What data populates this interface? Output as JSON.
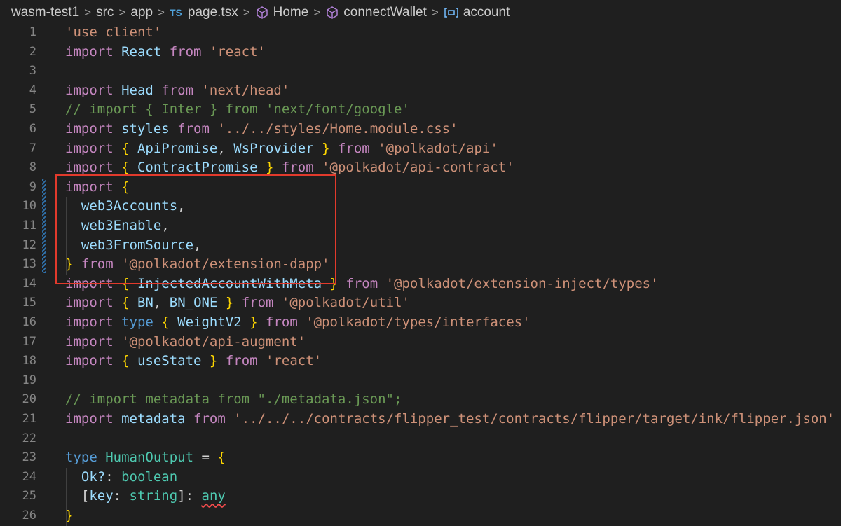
{
  "breadcrumb": {
    "project": "wasm-test1",
    "folder1": "src",
    "folder2": "app",
    "file_badge": "TS",
    "file": "page.tsx",
    "symbol1": "Home",
    "symbol2": "connectWallet",
    "symbol3": "account",
    "separator": ">"
  },
  "editor": {
    "lines": [
      {
        "n": "1",
        "tokens": [
          [
            "str",
            "'use client'"
          ]
        ]
      },
      {
        "n": "2",
        "tokens": [
          [
            "kw2",
            "import "
          ],
          [
            "id",
            "React "
          ],
          [
            "kw2",
            "from "
          ],
          [
            "str",
            "'react'"
          ]
        ]
      },
      {
        "n": "3",
        "tokens": []
      },
      {
        "n": "4",
        "tokens": [
          [
            "kw2",
            "import "
          ],
          [
            "id",
            "Head "
          ],
          [
            "kw2",
            "from "
          ],
          [
            "str",
            "'next/head'"
          ]
        ]
      },
      {
        "n": "5",
        "tokens": [
          [
            "cm",
            "// import { Inter } from 'next/font/google'"
          ]
        ]
      },
      {
        "n": "6",
        "tokens": [
          [
            "kw2",
            "import "
          ],
          [
            "id",
            "styles "
          ],
          [
            "kw2",
            "from "
          ],
          [
            "str",
            "'../../styles/Home.module.css'"
          ]
        ]
      },
      {
        "n": "7",
        "tokens": [
          [
            "kw2",
            "import "
          ],
          [
            "br",
            "{ "
          ],
          [
            "id",
            "ApiPromise"
          ],
          [
            "pl",
            ", "
          ],
          [
            "id",
            "WsProvider "
          ],
          [
            "br",
            "} "
          ],
          [
            "kw2",
            "from "
          ],
          [
            "str",
            "'@polkadot/api'"
          ]
        ]
      },
      {
        "n": "8",
        "tokens": [
          [
            "kw2",
            "import "
          ],
          [
            "br",
            "{ "
          ],
          [
            "id",
            "ContractPromise "
          ],
          [
            "br",
            "} "
          ],
          [
            "kw2",
            "from "
          ],
          [
            "str",
            "'@polkadot/api-contract'"
          ]
        ]
      },
      {
        "n": "9",
        "tokens": [
          [
            "kw2",
            "import "
          ],
          [
            "br",
            "{"
          ]
        ]
      },
      {
        "n": "10",
        "tokens": [
          [
            "pl",
            "  "
          ],
          [
            "id",
            "web3Accounts"
          ],
          [
            "pl",
            ","
          ]
        ]
      },
      {
        "n": "11",
        "tokens": [
          [
            "pl",
            "  "
          ],
          [
            "id",
            "web3Enable"
          ],
          [
            "pl",
            ","
          ]
        ]
      },
      {
        "n": "12",
        "tokens": [
          [
            "pl",
            "  "
          ],
          [
            "id",
            "web3FromSource"
          ],
          [
            "pl",
            ","
          ]
        ]
      },
      {
        "n": "13",
        "tokens": [
          [
            "br",
            "} "
          ],
          [
            "kw2",
            "from "
          ],
          [
            "str",
            "'@polkadot/extension-dapp'"
          ]
        ]
      },
      {
        "n": "14",
        "tokens": [
          [
            "kw2",
            "import "
          ],
          [
            "br",
            "{ "
          ],
          [
            "id",
            "InjectedAccountWithMeta "
          ],
          [
            "br",
            "} "
          ],
          [
            "kw2",
            "from "
          ],
          [
            "str",
            "'@polkadot/extension-inject/types'"
          ]
        ]
      },
      {
        "n": "15",
        "tokens": [
          [
            "kw2",
            "import "
          ],
          [
            "br",
            "{ "
          ],
          [
            "id",
            "BN"
          ],
          [
            "pl",
            ", "
          ],
          [
            "id",
            "BN_ONE "
          ],
          [
            "br",
            "} "
          ],
          [
            "kw2",
            "from "
          ],
          [
            "str",
            "'@polkadot/util'"
          ]
        ]
      },
      {
        "n": "16",
        "tokens": [
          [
            "kw2",
            "import "
          ],
          [
            "kw",
            "type "
          ],
          [
            "br",
            "{ "
          ],
          [
            "id",
            "WeightV2 "
          ],
          [
            "br",
            "} "
          ],
          [
            "kw2",
            "from "
          ],
          [
            "str",
            "'@polkadot/types/interfaces'"
          ]
        ]
      },
      {
        "n": "17",
        "tokens": [
          [
            "kw2",
            "import "
          ],
          [
            "str",
            "'@polkadot/api-augment'"
          ]
        ]
      },
      {
        "n": "18",
        "tokens": [
          [
            "kw2",
            "import "
          ],
          [
            "br",
            "{ "
          ],
          [
            "id",
            "useState "
          ],
          [
            "br",
            "} "
          ],
          [
            "kw2",
            "from "
          ],
          [
            "str",
            "'react'"
          ]
        ]
      },
      {
        "n": "19",
        "tokens": []
      },
      {
        "n": "20",
        "tokens": [
          [
            "cm",
            "// import metadata from \"./metadata.json\";"
          ]
        ]
      },
      {
        "n": "21",
        "tokens": [
          [
            "kw2",
            "import "
          ],
          [
            "id",
            "metadata "
          ],
          [
            "kw2",
            "from "
          ],
          [
            "str",
            "'../../../contracts/flipper_test/contracts/flipper/target/ink/flipper.json'"
          ]
        ]
      },
      {
        "n": "22",
        "tokens": []
      },
      {
        "n": "23",
        "tokens": [
          [
            "kw",
            "type "
          ],
          [
            "ty",
            "HumanOutput "
          ],
          [
            "pl",
            "= "
          ],
          [
            "br",
            "{"
          ]
        ]
      },
      {
        "n": "24",
        "tokens": [
          [
            "pl",
            "  "
          ],
          [
            "id",
            "Ok?"
          ],
          [
            "pl",
            ": "
          ],
          [
            "ty",
            "boolean"
          ]
        ]
      },
      {
        "n": "25",
        "tokens": [
          [
            "pl",
            "  ["
          ],
          [
            "id",
            "key"
          ],
          [
            "pl",
            ": "
          ],
          [
            "ty",
            "string"
          ],
          [
            "pl",
            "]: "
          ],
          [
            "ty squiggle",
            "any"
          ]
        ]
      },
      {
        "n": "26",
        "tokens": [
          [
            "br",
            "}"
          ]
        ]
      }
    ]
  },
  "colors": {
    "background": "#1f1f1f",
    "highlight_box": "#e23a2c"
  }
}
